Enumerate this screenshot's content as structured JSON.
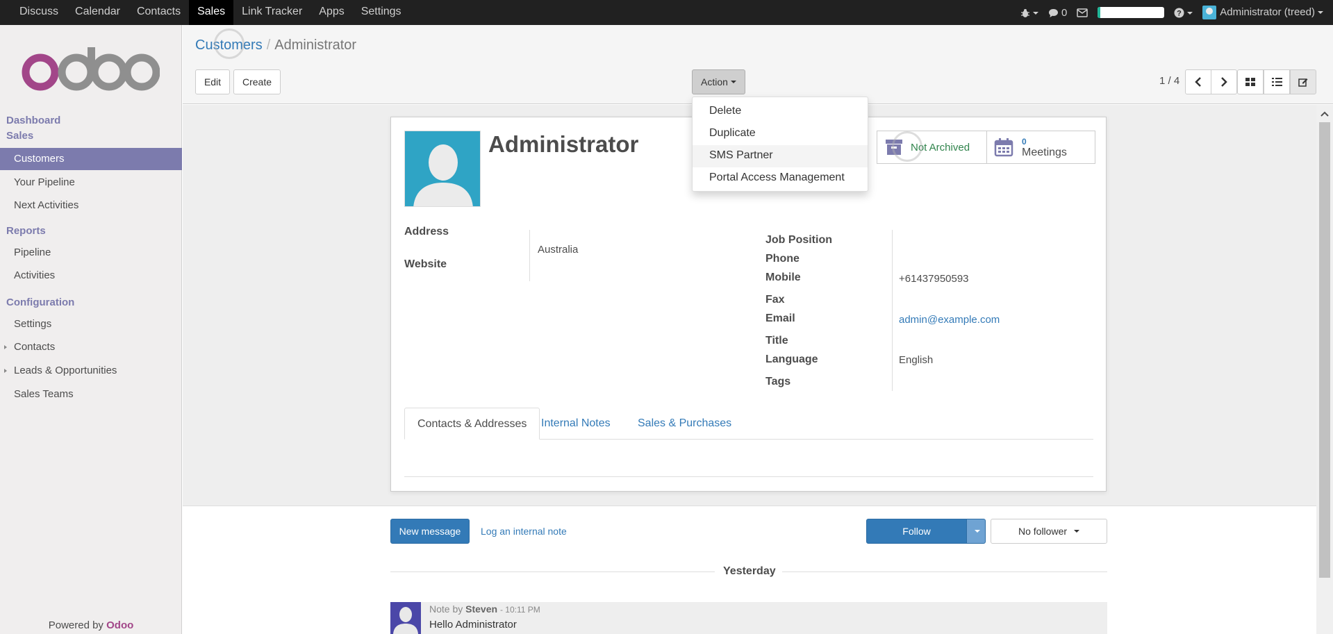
{
  "topbar": {
    "apps": [
      "Discuss",
      "Calendar",
      "Contacts",
      "Sales",
      "Link Tracker",
      "Apps",
      "Settings"
    ],
    "active_app": "Sales",
    "message_count": "0",
    "user": "Administrator (treed)",
    "progress_percent": 4
  },
  "sidebar": {
    "logo_text": "odoo",
    "heading_dashboard": "Dashboard",
    "heading_sales": "Sales",
    "sales_items": [
      "Customers",
      "Your Pipeline",
      "Next Activities"
    ],
    "heading_reports": "Reports",
    "report_items": [
      "Pipeline",
      "Activities"
    ],
    "heading_configuration": "Configuration",
    "config_items": [
      "Settings",
      "Contacts",
      "Leads & Opportunities",
      "Sales Teams"
    ],
    "powered_by": "Powered by",
    "powered_brand": "Odoo"
  },
  "control": {
    "breadcrumb_parent": "Customers",
    "breadcrumb_sep": "/",
    "breadcrumb_current": "Administrator",
    "edit_label": "Edit",
    "create_label": "Create",
    "action_label": "Action",
    "pager": "1 / 4"
  },
  "action_menu": [
    "Delete",
    "Duplicate",
    "SMS Partner",
    "Portal Access Management"
  ],
  "record": {
    "name": "Administrator",
    "archive_status": "Not Archived",
    "meetings_count": "0",
    "meetings_label": "Meetings",
    "labels": {
      "address": "Address",
      "website": "Website",
      "job_position": "Job Position",
      "phone": "Phone",
      "mobile": "Mobile",
      "fax": "Fax",
      "email": "Email",
      "title": "Title",
      "language": "Language",
      "tags": "Tags"
    },
    "values": {
      "country": "Australia",
      "mobile": "+61437950593",
      "email": "admin@example.com",
      "language": "English"
    },
    "tabs": [
      "Contacts & Addresses",
      "Internal Notes",
      "Sales & Purchases"
    ]
  },
  "chatter": {
    "new_message": "New message",
    "log_note": "Log an internal note",
    "follow": "Follow",
    "followers": "No follower",
    "date_separator": "Yesterday",
    "message": {
      "prefix": "Note by",
      "author": "Steven",
      "time": "- 10:11 PM",
      "body": "Hello Administrator"
    }
  },
  "colors": {
    "topbar": "#212121",
    "sidebar_active": "#7c7bad",
    "link": "#337ab7",
    "primary_button": "#337ab7",
    "brand": "#a24689"
  }
}
